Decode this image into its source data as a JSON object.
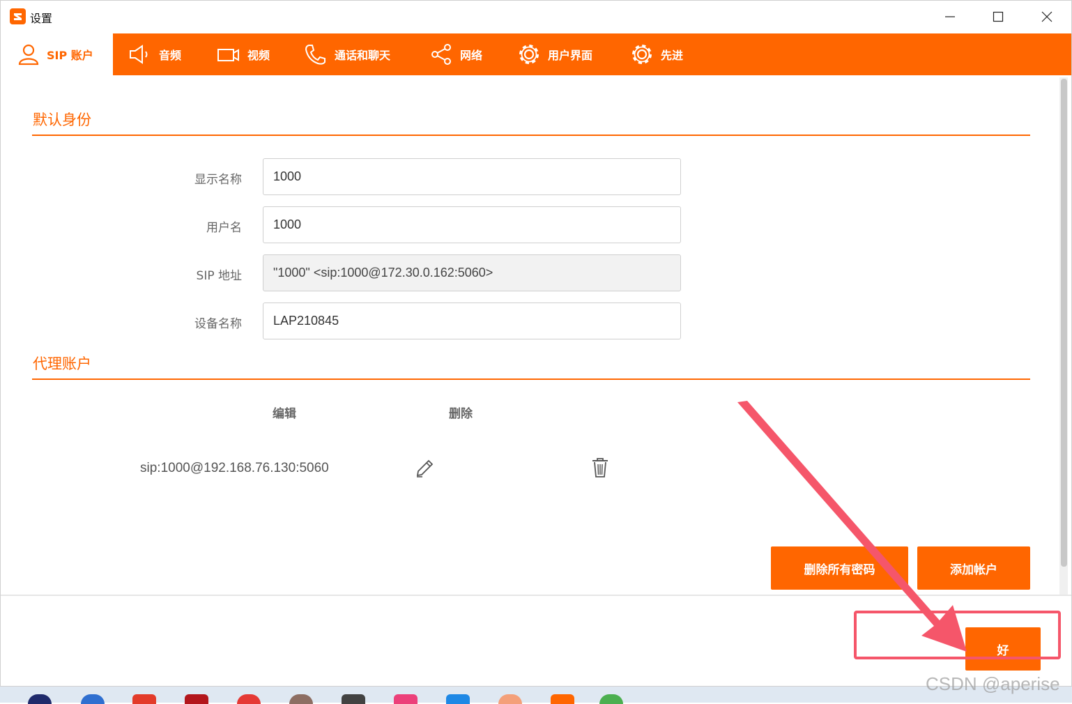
{
  "window": {
    "title": "设置"
  },
  "tabs": [
    {
      "label": "SIP 账户",
      "icon": "user-icon",
      "active": true
    },
    {
      "label": "音频",
      "icon": "speaker-icon"
    },
    {
      "label": "视频",
      "icon": "video-camera-icon"
    },
    {
      "label": "通话和聊天",
      "icon": "phone-icon"
    },
    {
      "label": "网络",
      "icon": "share-network-icon"
    },
    {
      "label": "用户界面",
      "icon": "gear-icon"
    },
    {
      "label": "先进",
      "icon": "gear-icon"
    }
  ],
  "identity": {
    "title": "默认身份",
    "fields": [
      {
        "label": "显示名称",
        "value": "1000"
      },
      {
        "label": "用户名",
        "value": "1000"
      },
      {
        "label": "SIP 地址",
        "value": "\"1000\" <sip:1000@172.30.0.162:5060>"
      },
      {
        "label": "设备名称",
        "value": "LAP210845"
      }
    ]
  },
  "proxy": {
    "title": "代理账户",
    "columns": {
      "edit": "编辑",
      "delete": "删除"
    },
    "accounts": [
      {
        "address": "sip:1000@192.168.76.130:5060"
      }
    ],
    "buttons": {
      "delete_passwords": "删除所有密码",
      "add_account": "添加帐户"
    }
  },
  "footer": {
    "ok": "好"
  },
  "watermark": "CSDN @aperise",
  "colors": {
    "accent": "#ff6600",
    "annotation": "#f5566a"
  }
}
